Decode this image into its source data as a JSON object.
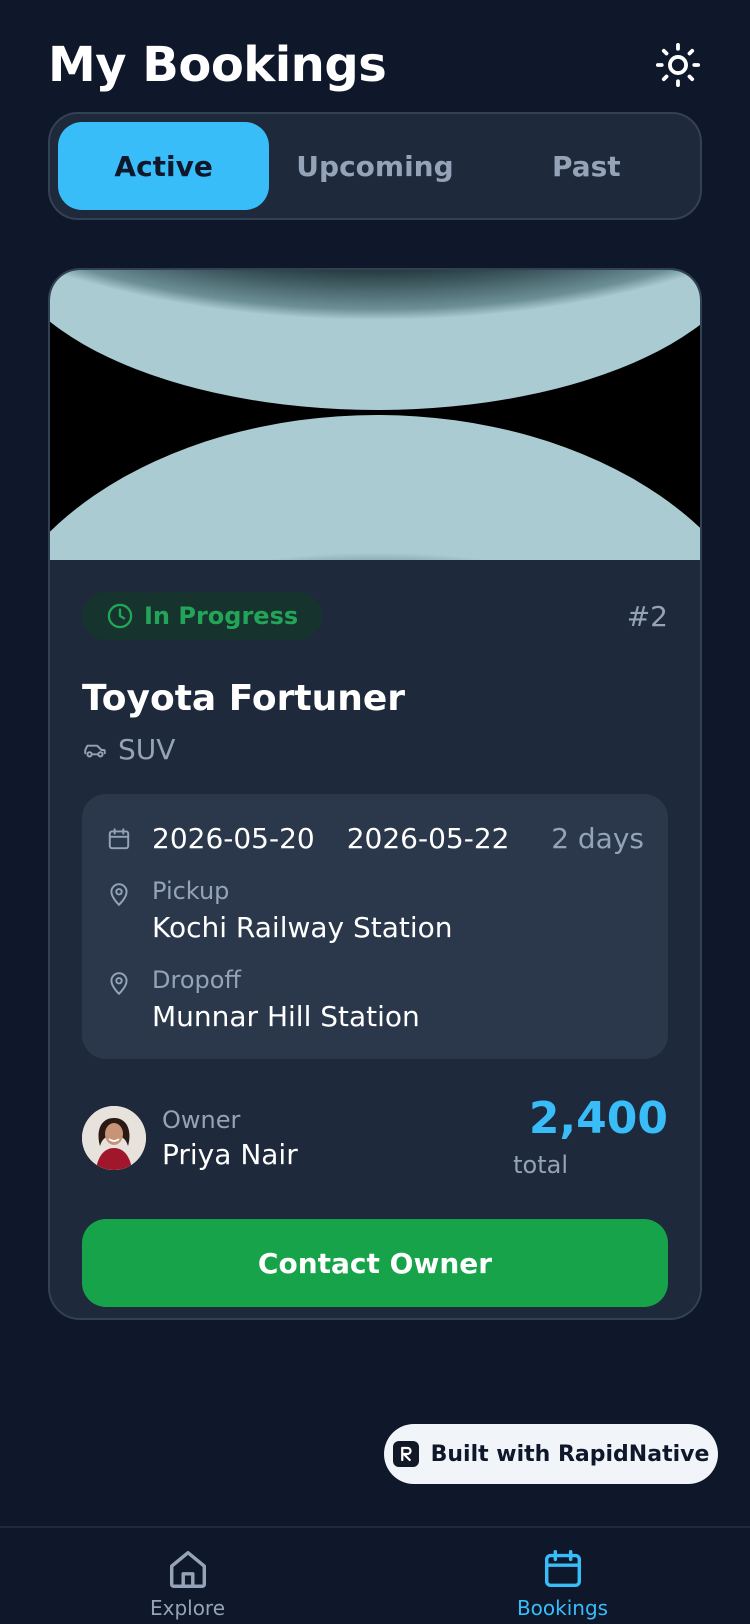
{
  "header": {
    "title": "My Bookings",
    "theme_icon": "sun-icon"
  },
  "tabs": [
    {
      "label": "Active",
      "active": true
    },
    {
      "label": "Upcoming",
      "active": false
    },
    {
      "label": "Past",
      "active": false
    }
  ],
  "booking": {
    "status": "In Progress",
    "id": "#2",
    "car_name": "Toyota Fortuner",
    "car_type": "SUV",
    "start_date": "2026-05-20",
    "end_date": "2026-05-22",
    "duration": "2 days",
    "pickup_label": "Pickup",
    "pickup_location": "Kochi Railway Station",
    "dropoff_label": "Dropoff",
    "dropoff_location": "Munnar Hill Station",
    "owner_label": "Owner",
    "owner_name": "Priya Nair",
    "price": "2,400",
    "price_label": "total",
    "contact_label": "Contact Owner"
  },
  "badge": {
    "label": "Built with RapidNative"
  },
  "nav": [
    {
      "label": "Explore",
      "icon": "home-icon",
      "active": false
    },
    {
      "label": "Bookings",
      "icon": "calendar-icon",
      "active": true
    }
  ],
  "colors": {
    "background": "#0f172a",
    "card": "#1e293b",
    "accent": "#38bdf8",
    "success": "#16a34a",
    "muted": "#94a3b8"
  }
}
